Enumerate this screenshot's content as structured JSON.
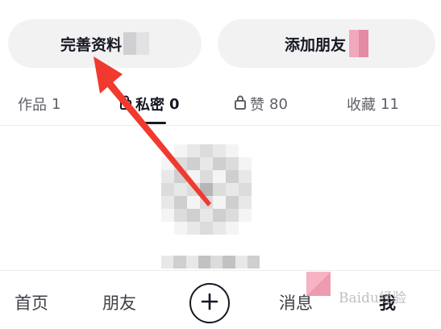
{
  "actions": {
    "edit_profile_label": "完善资料",
    "add_friends_label": "添加朋友"
  },
  "tabs": [
    {
      "label": "作品",
      "count": "1"
    },
    {
      "label": "私密",
      "count": "0"
    },
    {
      "label": "赞",
      "count": "80"
    },
    {
      "label": "收藏",
      "count": "11"
    }
  ],
  "bottom_nav": {
    "home": "首页",
    "friends": "朋友",
    "plus": "+",
    "messages": "消息",
    "me": "我"
  },
  "watermark": "Baidu经验",
  "colors": {
    "annotation_arrow": "#f03a2f",
    "pill_background": "#f2f2f3",
    "text_primary": "#161823",
    "text_secondary": "#5e5f66"
  },
  "icons": {
    "private_tab": "lock-icon",
    "likes_tab": "lock-icon",
    "create": "plus-circle-icon"
  }
}
